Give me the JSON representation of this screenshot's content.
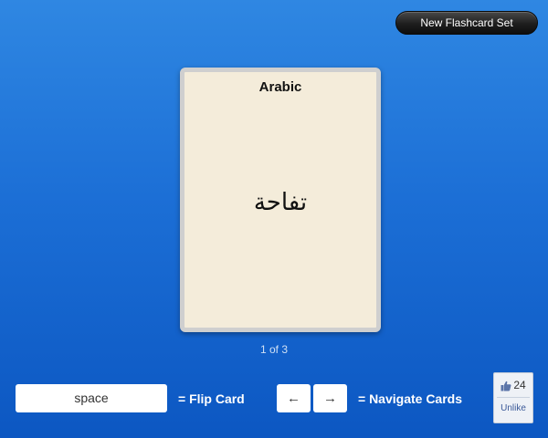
{
  "header": {
    "new_set_label": "New Flashcard Set"
  },
  "card": {
    "language": "Arabic",
    "word": "تفاحة"
  },
  "counter": "1 of 3",
  "controls": {
    "flip_key": "space",
    "flip_label": "= Flip Card",
    "prev_key": "←",
    "next_key": "→",
    "navigate_label": "= Navigate Cards"
  },
  "like": {
    "icon": "thumbs-up-icon",
    "count": "24",
    "unlike_label": "Unlike"
  },
  "colors": {
    "background_top": "#2f87e2",
    "background_bottom": "#0c57c2",
    "card": "#f4ecda",
    "button_dark": "#1e1e1e",
    "link": "#3b5998"
  }
}
